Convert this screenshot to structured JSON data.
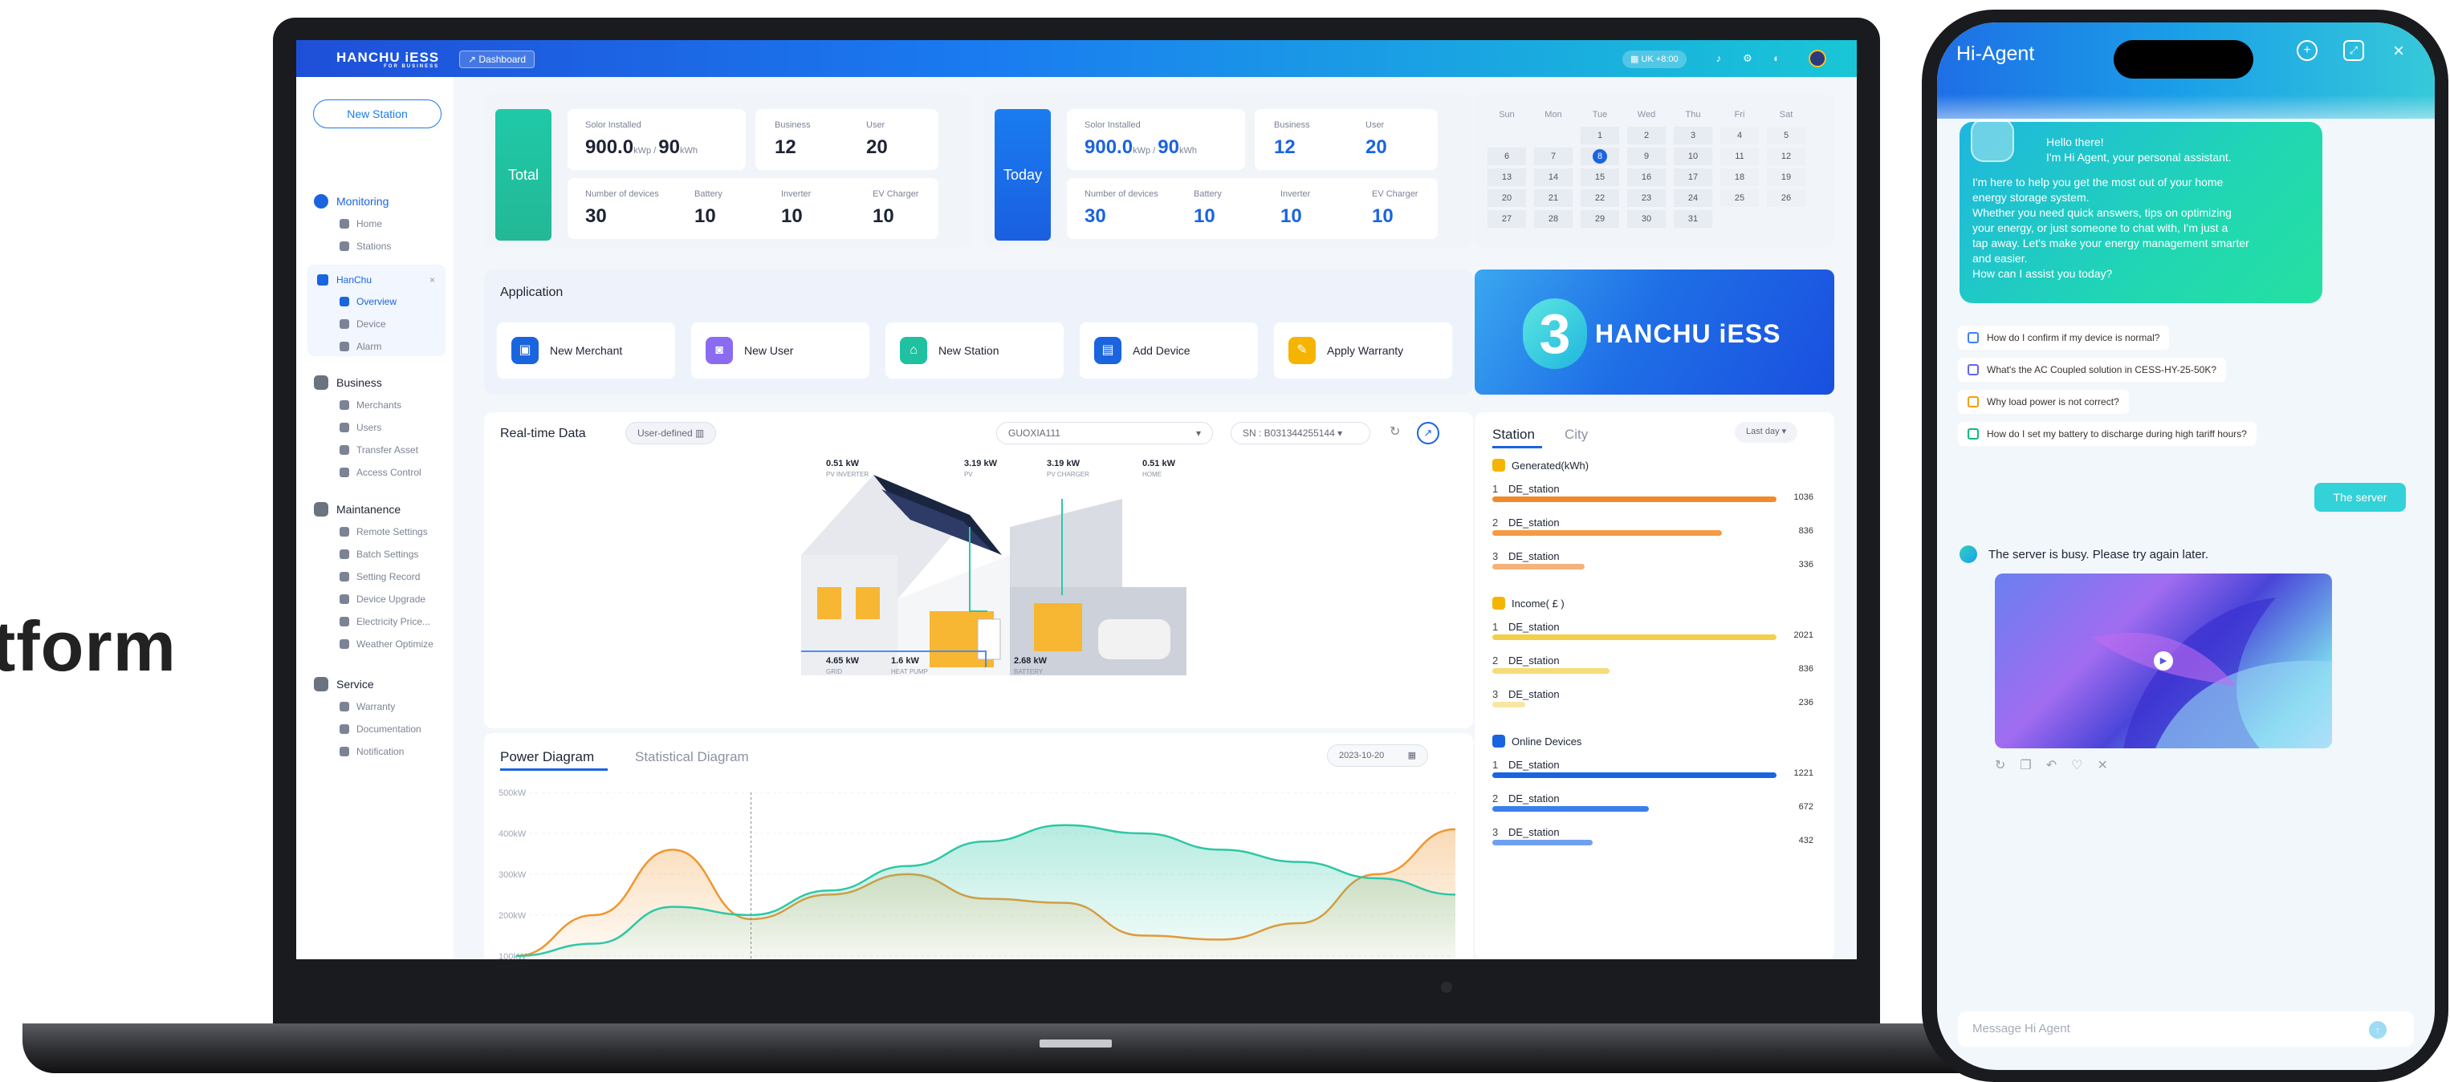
{
  "hero_word": "tform",
  "app": {
    "logo": "HANCHU iESS",
    "logo_sub": "FOR BUSINESS",
    "dashboard_btn": "Dashboard",
    "timezone": "UK +8:00"
  },
  "sidebar": {
    "new_station": "New Station",
    "monitoring": "Monitoring",
    "monitoring_items": [
      "Home",
      "Stations"
    ],
    "hanchu": "HanChu",
    "hanchu_items": [
      "Overview",
      "Device",
      "Alarm"
    ],
    "business": "Business",
    "business_items": [
      "Merchants",
      "Users",
      "Transfer Asset",
      "Access Control"
    ],
    "maintenance": "Maintanence",
    "maintenance_items": [
      "Remote Settings",
      "Batch Settings",
      "Setting Record",
      "Device Upgrade",
      "Electricity Price...",
      "Weather Optimize"
    ],
    "service": "Service",
    "service_items": [
      "Warranty",
      "Documentation",
      "Notification"
    ]
  },
  "total": {
    "label": "Total",
    "solar_label": "Solor Installed",
    "solar_value": "900.0",
    "solar_unit": "kWp",
    "storage_value": "90",
    "storage_unit": "kWh",
    "business_label": "Business",
    "business_value": "12",
    "user_label": "User",
    "user_value": "20",
    "devices_label": "Number of devices",
    "devices_value": "30",
    "battery_label": "Battery",
    "battery_value": "10",
    "inverter_label": "Inverter",
    "inverter_value": "10",
    "ev_label": "EV Charger",
    "ev_value": "10"
  },
  "today": {
    "label": "Today",
    "solar_label": "Solor Installed",
    "solar_value": "900.0",
    "solar_unit": "kWp",
    "storage_value": "90",
    "storage_unit": "kWh",
    "business_label": "Business",
    "business_value": "12",
    "user_label": "User",
    "user_value": "20",
    "devices_label": "Number of devices",
    "devices_value": "30",
    "battery_label": "Battery",
    "battery_value": "10",
    "inverter_label": "Inverter",
    "inverter_value": "10",
    "ev_label": "EV Charger",
    "ev_value": "10"
  },
  "calendar": {
    "weekdays": [
      "Sun",
      "Mon",
      "Tue",
      "Wed",
      "Thu",
      "Fri",
      "Sat"
    ],
    "rows": [
      [
        "",
        "",
        "1",
        "2",
        "3",
        "4",
        "5"
      ],
      [
        "6",
        "7",
        "8",
        "9",
        "10",
        "11",
        "12"
      ],
      [
        "13",
        "14",
        "15",
        "16",
        "17",
        "18",
        "19"
      ],
      [
        "20",
        "21",
        "22",
        "23",
        "24",
        "25",
        "26"
      ],
      [
        "27",
        "28",
        "29",
        "30",
        "31",
        "",
        ""
      ]
    ],
    "selected": "8"
  },
  "application": {
    "title": "Application",
    "buttons": [
      {
        "label": "New Merchant",
        "color": "#1a64e0"
      },
      {
        "label": "New User",
        "color": "#8b6cf0"
      },
      {
        "label": "New Station",
        "color": "#1fc1a0"
      },
      {
        "label": "Add Device",
        "color": "#1a64e0"
      },
      {
        "label": "Apply Warranty",
        "color": "#f5b400"
      }
    ]
  },
  "banner": {
    "text": "HANCHU iESS"
  },
  "realtime": {
    "title": "Real-time Data",
    "mode": "User-defined",
    "station": "GUOXIA111",
    "sn": "SN : B031344255144",
    "readouts": [
      {
        "value": "0.51",
        "label": "PV INVERTER"
      },
      {
        "value": "3.19",
        "label": "PV"
      },
      {
        "value": "3.19",
        "label": "PV CHARGER"
      },
      {
        "value": "0.51",
        "label": "HOME"
      },
      {
        "value": "4.65",
        "label": "GRID"
      },
      {
        "value": "1.6",
        "label": "HEAT PUMP"
      },
      {
        "value": "2.68",
        "label": "BATTERY"
      }
    ]
  },
  "station_rank": {
    "tab_station": "Station",
    "tab_city": "City",
    "period": "Last day",
    "generated_title": "Generated(kWh)",
    "income_title": "Income( £ )",
    "devices_title": "Online Devices",
    "generated": [
      {
        "rank": "1",
        "name": "DE_station",
        "value": 1036,
        "color": "#f08a2a"
      },
      {
        "rank": "2",
        "name": "DE_station",
        "value": 836,
        "color": "#f39b45"
      },
      {
        "rank": "3",
        "name": "DE_station",
        "value": 336,
        "color": "#f5b27a"
      }
    ],
    "income": [
      {
        "rank": "1",
        "name": "DE_station",
        "value": 2021,
        "color": "#f3cf4a"
      },
      {
        "rank": "2",
        "name": "DE_station",
        "value": 836,
        "color": "#f6dc78"
      },
      {
        "rank": "3",
        "name": "DE_station",
        "value": 236,
        "color": "#f8e6a3"
      }
    ],
    "devices": [
      {
        "rank": "1",
        "name": "DE_station",
        "value": 1221,
        "color": "#1a64e0"
      },
      {
        "rank": "2",
        "name": "DE_station",
        "value": 672,
        "color": "#3b7fea"
      },
      {
        "rank": "3",
        "name": "DE_station",
        "value": 432,
        "color": "#6fa0f0"
      }
    ]
  },
  "power": {
    "tab_power": "Power Diagram",
    "tab_stat": "Statistical Diagram",
    "date": "2023-10-20"
  },
  "chart_data": {
    "type": "area",
    "yticks": [
      "500kW",
      "400kW",
      "300kW",
      "200kW",
      "100kW"
    ],
    "ylim": [
      80,
      500
    ],
    "x": [
      0,
      1,
      2,
      3,
      4,
      5,
      6,
      7,
      8,
      9,
      10,
      11,
      12
    ],
    "series": [
      {
        "values": [
          100,
          200,
          360,
          190,
          250,
          300,
          240,
          230,
          150,
          140,
          180,
          300,
          410
        ],
        "color": "#f0962f"
      },
      {
        "values": [
          100,
          130,
          220,
          200,
          260,
          320,
          380,
          420,
          400,
          360,
          330,
          290,
          250
        ],
        "color": "#2fc7a6"
      }
    ]
  },
  "agent": {
    "title": "Hi-Agent",
    "greeting_1": "Hello there!",
    "greeting_2": "I'm Hi Agent, your personal assistant.",
    "intro_lines": [
      "I'm here to help you get the most out of your home",
      "energy storage system.",
      "Whether you need quick answers, tips on optimizing",
      "your energy, or just someone to chat with, I'm just a",
      "tap away. Let's make your energy management smarter",
      "and easier.",
      "How can I assist you today?"
    ],
    "questions": [
      "How do I confirm if my device is normal?",
      "What's the AC Coupled solution in CESS-HY-25-50K?",
      "Why load power is not correct?",
      "How do I set my battery to discharge during high tariff hours?"
    ],
    "user_message": "The server",
    "bot_message": "The server is busy. Please try again later.",
    "input_placeholder": "Message Hi Agent"
  }
}
